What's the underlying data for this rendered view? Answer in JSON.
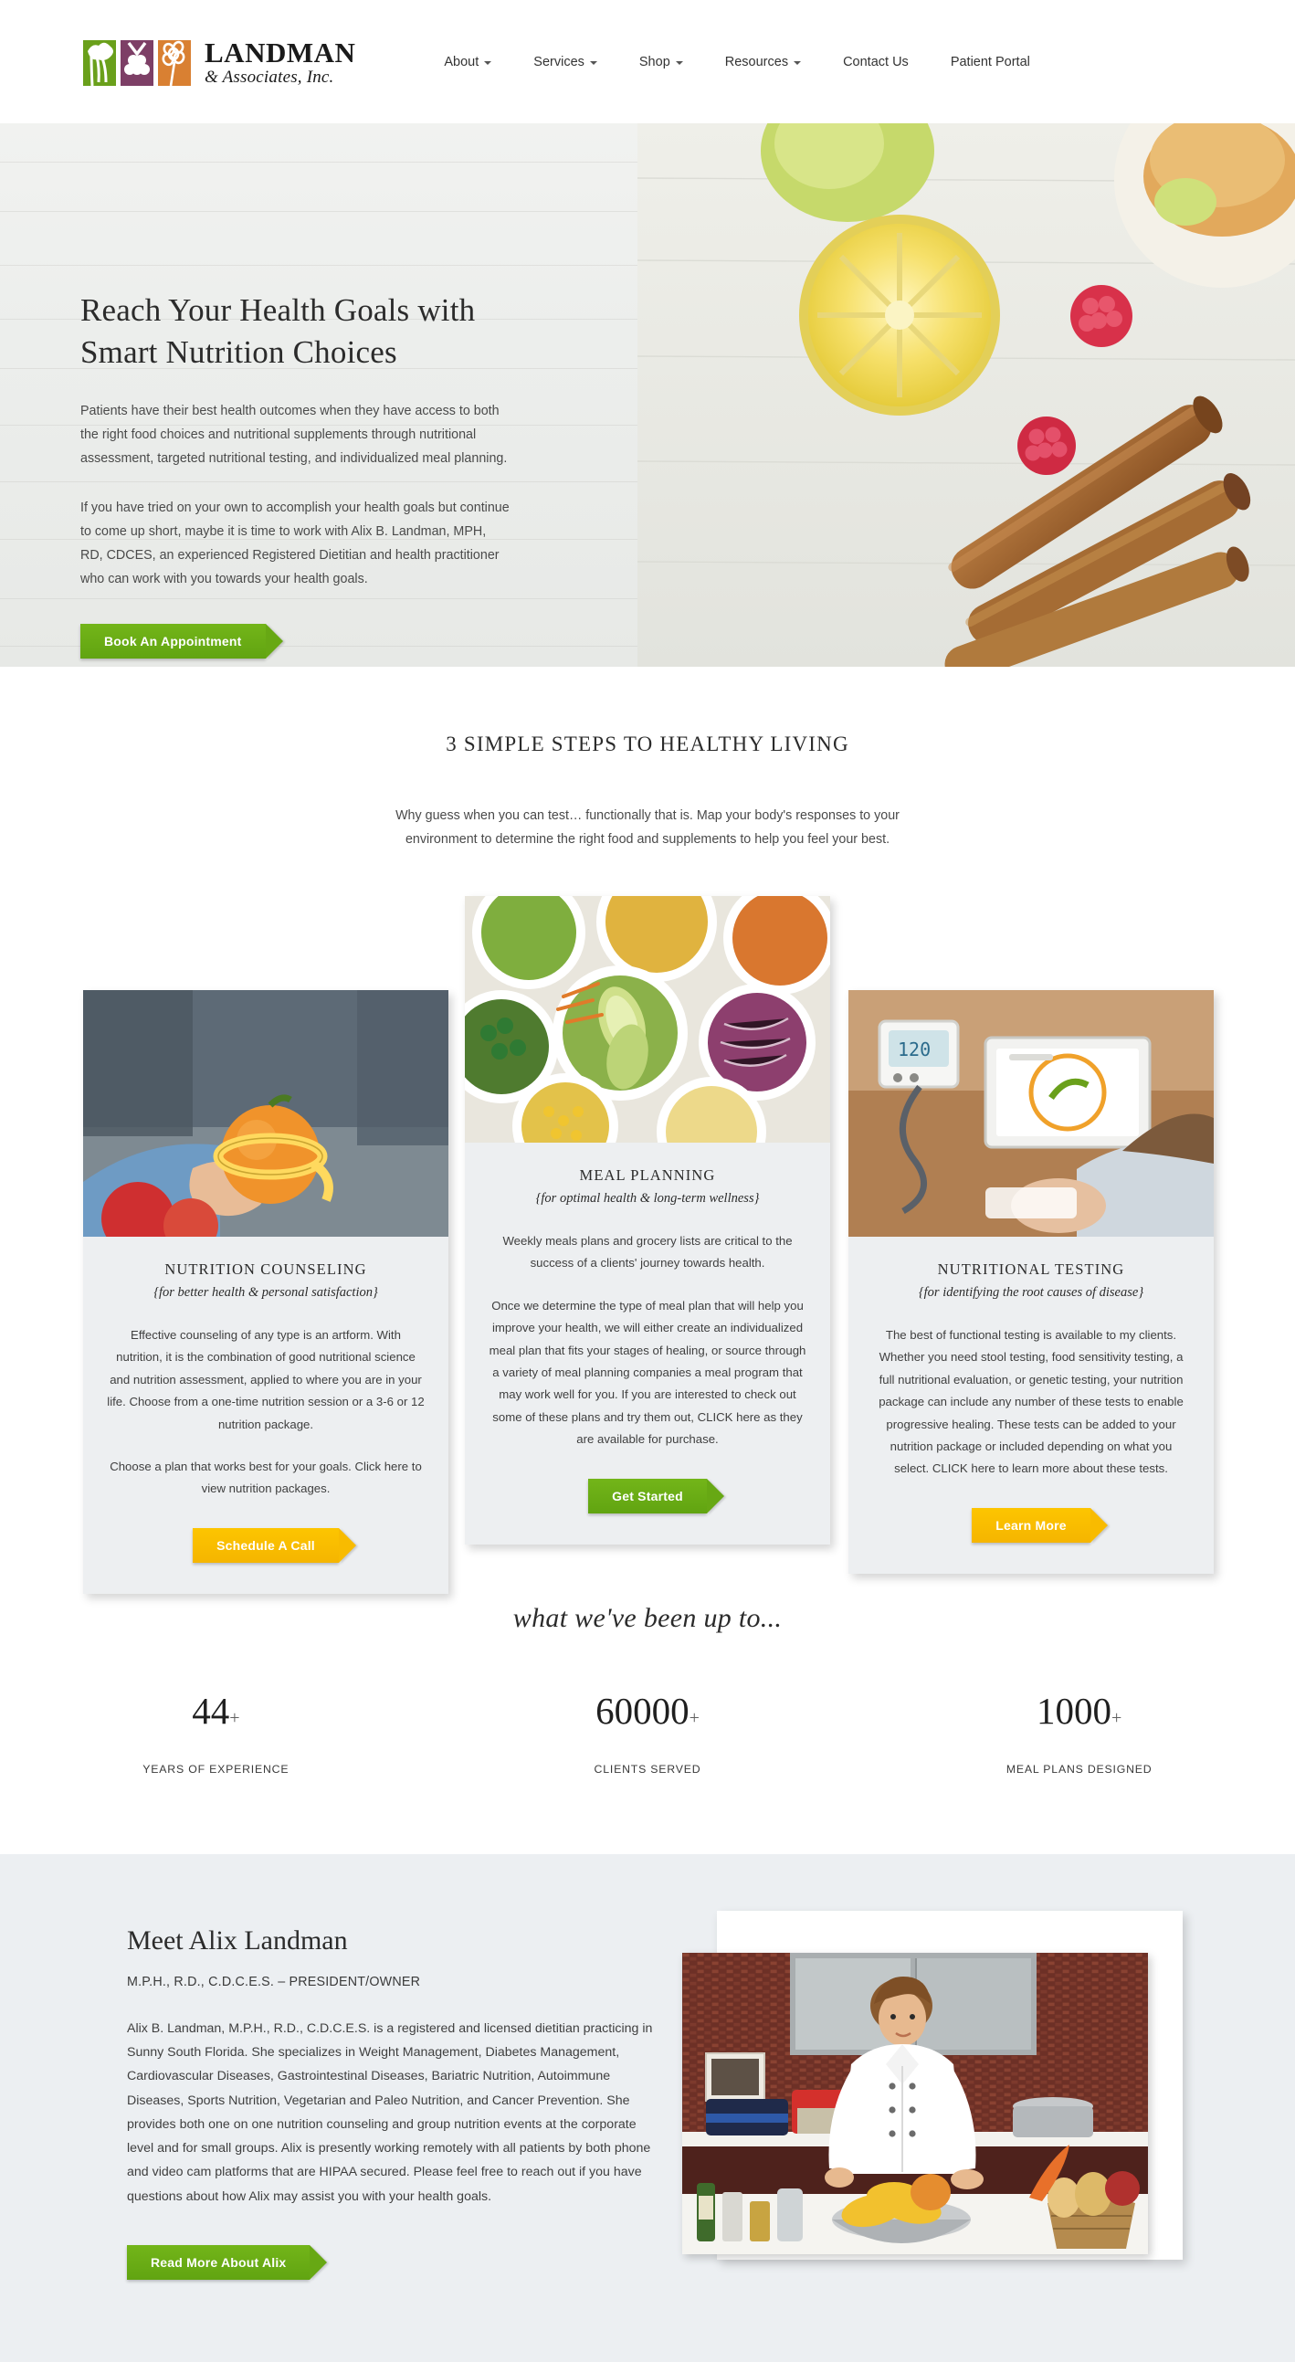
{
  "header": {
    "logo": {
      "name": "LANDMAN",
      "sub": "& Associates, Inc.",
      "mark_colors": [
        "#6aa01b",
        "#7d3f66",
        "#d98032"
      ]
    },
    "nav": [
      {
        "label": "About",
        "has_dropdown": true
      },
      {
        "label": "Services",
        "has_dropdown": true
      },
      {
        "label": "Shop",
        "has_dropdown": true
      },
      {
        "label": "Resources",
        "has_dropdown": true
      },
      {
        "label": "Contact Us",
        "has_dropdown": false
      },
      {
        "label": "Patient Portal",
        "has_dropdown": false
      }
    ]
  },
  "hero": {
    "title": "Reach Your Health Goals with Smart Nutrition Choices",
    "paragraph1": "Patients have their best health outcomes when they have access to both the right food choices and nutritional supplements through nutritional assessment, targeted nutritional testing, and individualized meal planning.",
    "paragraph2": "If you have tried on your own to accomplish your health goals but continue to come up short, maybe it is time to work with Alix B. Landman, MPH, RD, CDCES, an experienced Registered Dietitian and health practitioner who can work with you towards your health goals.",
    "cta_label": "Book An Appointment"
  },
  "steps": {
    "title": "3 SIMPLE STEPS TO HEALTHY LIVING",
    "subtitle": "Why guess when you can test… functionally that is. Map your body's responses to your environment to determine the right food and supplements to help you feel your best.",
    "cards": [
      {
        "title": "NUTRITION COUNSELING",
        "subtitle": "{for better health & personal satisfaction}",
        "paragraph1": "Effective counseling of any type is an artform. With nutrition, it is the combination of good nutritional science and nutrition assessment, applied to where you are in your life. Choose from a one-time nutrition session or a 3-6 or 12 nutrition package.",
        "paragraph2": "Choose a plan that works best for your goals. Click here to view nutrition packages.",
        "button_label": "Schedule A Call",
        "button_color": "amber",
        "image_alt": "hand holding orange with tape measure"
      },
      {
        "title": "MEAL PLANNING",
        "subtitle": "{for optimal health & long-term wellness}",
        "paragraph1": "Weekly meals plans and grocery lists are critical to the success of a clients' journey towards health.",
        "paragraph2": "Once we determine the type of meal plan that will help you improve your health, we will either create an individualized meal plan that fits your stages of healing, or source through a variety of meal planning companies a meal program that may work well for you. If you are interested to check out some of these plans and try them out, CLICK here as they are available for purchase.",
        "button_label": "Get Started",
        "button_color": "green",
        "image_alt": "bowls of fresh salad with avocado and vegetables"
      },
      {
        "title": "NUTRITIONAL TESTING",
        "subtitle": "{for identifying the root causes of disease}",
        "paragraph1": "The best of functional testing is available to my clients. Whether you need stool testing, food sensitivity testing, a full nutritional evaluation, or genetic testing, your nutrition package can include any number of these tests to enable progressive healing. These tests can be added to your nutrition package or included depending on what you select. CLICK here to learn more about these tests.",
        "paragraph2": "",
        "button_label": "Learn More",
        "button_color": "amber",
        "image_alt": "blood pressure monitor and tablet on desk"
      }
    ]
  },
  "stats": {
    "heading": "what we've been up to...",
    "items": [
      {
        "value": "44",
        "plus": "+",
        "label": "YEARS OF EXPERIENCE"
      },
      {
        "value": "60000",
        "plus": "+",
        "label": "CLIENTS SERVED"
      },
      {
        "value": "1000",
        "plus": "+",
        "label": "MEAL PLANS DESIGNED"
      }
    ]
  },
  "about": {
    "title": "Meet Alix Landman",
    "role": "M.P.H., R.D., C.D.C.E.S. – PRESIDENT/OWNER",
    "bio": "Alix B. Landman, M.P.H., R.D., C.D.C.E.S. is a registered and licensed dietitian practicing in Sunny South Florida. She specializes in Weight Management, Diabetes Management, Cardiovascular Diseases, Gastrointestinal Diseases, Bariatric Nutrition, Autoimmune Diseases, Sports Nutrition, Vegetarian and Paleo Nutrition, and Cancer Prevention. She provides both one on one nutrition counseling and group nutrition events at the corporate level and for small groups. Alix is presently working remotely with all patients by both phone and video cam platforms that are HIPAA secured. Please feel free to reach out if you have questions about how Alix may assist you with your health goals.",
    "button_label": "Read More About Alix",
    "image_alt": "Alix Landman in chef coat in a kitchen with squash and vegetables"
  },
  "colors": {
    "green": "#67a814",
    "amber": "#f8bb00",
    "card_bg": "#edeff1",
    "about_bg": "#eceff2"
  }
}
